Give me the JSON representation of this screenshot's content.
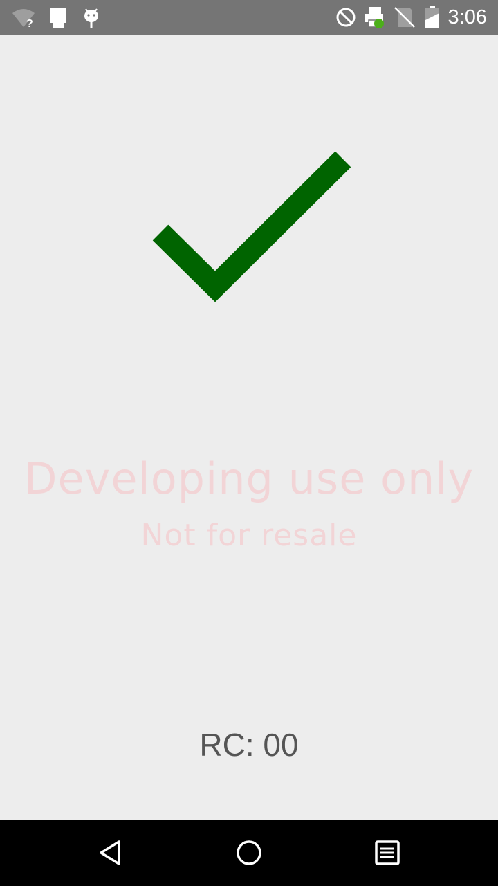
{
  "status_bar": {
    "time": "3:06",
    "background_color": "#757575",
    "left_icons": [
      "wifi-unknown-icon",
      "sim-card-icon",
      "android-debug-icon"
    ],
    "right_icons": [
      "do-not-disturb-icon",
      "printer-icon",
      "no-sim-icon",
      "battery-charging-icon"
    ]
  },
  "result": {
    "icon": "checkmark-icon",
    "icon_color": "#006400",
    "rc_label": "RC: 00",
    "rc_color": "#555555"
  },
  "watermark": {
    "title": "Developing use only",
    "subtitle": "Not for resale",
    "color": "#f2d4d6"
  },
  "nav_bar": {
    "buttons": [
      "back-icon",
      "home-icon",
      "recents-icon"
    ]
  }
}
